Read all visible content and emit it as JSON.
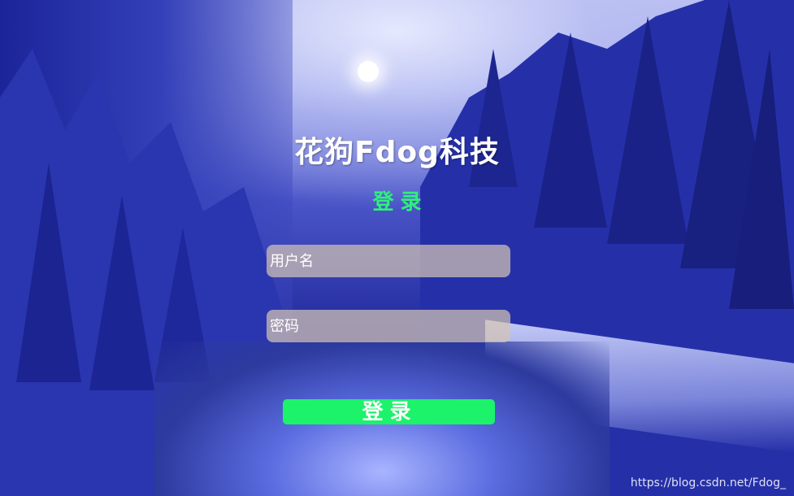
{
  "app": {
    "title": "花狗Fdog科技",
    "subtitle": "登录"
  },
  "form": {
    "username_placeholder": "用户名",
    "username_value": "",
    "password_placeholder": "密码",
    "password_value": "",
    "login_label": "登录"
  },
  "watermark": "https://blog.csdn.net/Fdog_",
  "colors": {
    "accent_green": "#1cf26a",
    "subtitle_green": "#2ef07a",
    "field_background": "rgba(210,195,180,0.72)"
  }
}
